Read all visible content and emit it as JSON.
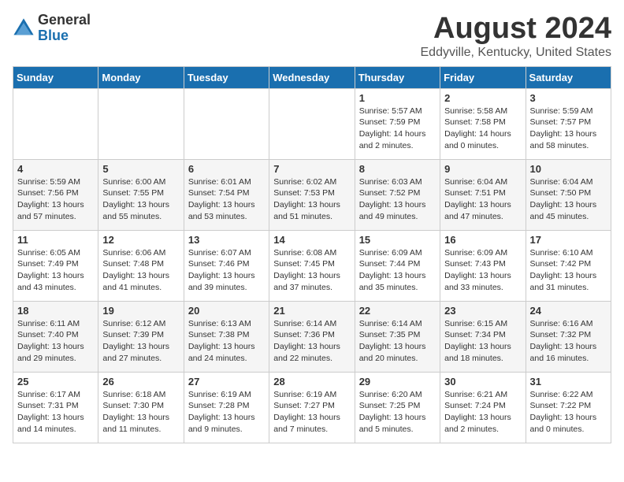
{
  "logo": {
    "general": "General",
    "blue": "Blue"
  },
  "title": {
    "month_year": "August 2024",
    "location": "Eddyville, Kentucky, United States"
  },
  "headers": [
    "Sunday",
    "Monday",
    "Tuesday",
    "Wednesday",
    "Thursday",
    "Friday",
    "Saturday"
  ],
  "weeks": [
    [
      {
        "day": "",
        "content": ""
      },
      {
        "day": "",
        "content": ""
      },
      {
        "day": "",
        "content": ""
      },
      {
        "day": "",
        "content": ""
      },
      {
        "day": "1",
        "content": "Sunrise: 5:57 AM\nSunset: 7:59 PM\nDaylight: 14 hours\nand 2 minutes."
      },
      {
        "day": "2",
        "content": "Sunrise: 5:58 AM\nSunset: 7:58 PM\nDaylight: 14 hours\nand 0 minutes."
      },
      {
        "day": "3",
        "content": "Sunrise: 5:59 AM\nSunset: 7:57 PM\nDaylight: 13 hours\nand 58 minutes."
      }
    ],
    [
      {
        "day": "4",
        "content": "Sunrise: 5:59 AM\nSunset: 7:56 PM\nDaylight: 13 hours\nand 57 minutes."
      },
      {
        "day": "5",
        "content": "Sunrise: 6:00 AM\nSunset: 7:55 PM\nDaylight: 13 hours\nand 55 minutes."
      },
      {
        "day": "6",
        "content": "Sunrise: 6:01 AM\nSunset: 7:54 PM\nDaylight: 13 hours\nand 53 minutes."
      },
      {
        "day": "7",
        "content": "Sunrise: 6:02 AM\nSunset: 7:53 PM\nDaylight: 13 hours\nand 51 minutes."
      },
      {
        "day": "8",
        "content": "Sunrise: 6:03 AM\nSunset: 7:52 PM\nDaylight: 13 hours\nand 49 minutes."
      },
      {
        "day": "9",
        "content": "Sunrise: 6:04 AM\nSunset: 7:51 PM\nDaylight: 13 hours\nand 47 minutes."
      },
      {
        "day": "10",
        "content": "Sunrise: 6:04 AM\nSunset: 7:50 PM\nDaylight: 13 hours\nand 45 minutes."
      }
    ],
    [
      {
        "day": "11",
        "content": "Sunrise: 6:05 AM\nSunset: 7:49 PM\nDaylight: 13 hours\nand 43 minutes."
      },
      {
        "day": "12",
        "content": "Sunrise: 6:06 AM\nSunset: 7:48 PM\nDaylight: 13 hours\nand 41 minutes."
      },
      {
        "day": "13",
        "content": "Sunrise: 6:07 AM\nSunset: 7:46 PM\nDaylight: 13 hours\nand 39 minutes."
      },
      {
        "day": "14",
        "content": "Sunrise: 6:08 AM\nSunset: 7:45 PM\nDaylight: 13 hours\nand 37 minutes."
      },
      {
        "day": "15",
        "content": "Sunrise: 6:09 AM\nSunset: 7:44 PM\nDaylight: 13 hours\nand 35 minutes."
      },
      {
        "day": "16",
        "content": "Sunrise: 6:09 AM\nSunset: 7:43 PM\nDaylight: 13 hours\nand 33 minutes."
      },
      {
        "day": "17",
        "content": "Sunrise: 6:10 AM\nSunset: 7:42 PM\nDaylight: 13 hours\nand 31 minutes."
      }
    ],
    [
      {
        "day": "18",
        "content": "Sunrise: 6:11 AM\nSunset: 7:40 PM\nDaylight: 13 hours\nand 29 minutes."
      },
      {
        "day": "19",
        "content": "Sunrise: 6:12 AM\nSunset: 7:39 PM\nDaylight: 13 hours\nand 27 minutes."
      },
      {
        "day": "20",
        "content": "Sunrise: 6:13 AM\nSunset: 7:38 PM\nDaylight: 13 hours\nand 24 minutes."
      },
      {
        "day": "21",
        "content": "Sunrise: 6:14 AM\nSunset: 7:36 PM\nDaylight: 13 hours\nand 22 minutes."
      },
      {
        "day": "22",
        "content": "Sunrise: 6:14 AM\nSunset: 7:35 PM\nDaylight: 13 hours\nand 20 minutes."
      },
      {
        "day": "23",
        "content": "Sunrise: 6:15 AM\nSunset: 7:34 PM\nDaylight: 13 hours\nand 18 minutes."
      },
      {
        "day": "24",
        "content": "Sunrise: 6:16 AM\nSunset: 7:32 PM\nDaylight: 13 hours\nand 16 minutes."
      }
    ],
    [
      {
        "day": "25",
        "content": "Sunrise: 6:17 AM\nSunset: 7:31 PM\nDaylight: 13 hours\nand 14 minutes."
      },
      {
        "day": "26",
        "content": "Sunrise: 6:18 AM\nSunset: 7:30 PM\nDaylight: 13 hours\nand 11 minutes."
      },
      {
        "day": "27",
        "content": "Sunrise: 6:19 AM\nSunset: 7:28 PM\nDaylight: 13 hours\nand 9 minutes."
      },
      {
        "day": "28",
        "content": "Sunrise: 6:19 AM\nSunset: 7:27 PM\nDaylight: 13 hours\nand 7 minutes."
      },
      {
        "day": "29",
        "content": "Sunrise: 6:20 AM\nSunset: 7:25 PM\nDaylight: 13 hours\nand 5 minutes."
      },
      {
        "day": "30",
        "content": "Sunrise: 6:21 AM\nSunset: 7:24 PM\nDaylight: 13 hours\nand 2 minutes."
      },
      {
        "day": "31",
        "content": "Sunrise: 6:22 AM\nSunset: 7:22 PM\nDaylight: 13 hours\nand 0 minutes."
      }
    ]
  ]
}
